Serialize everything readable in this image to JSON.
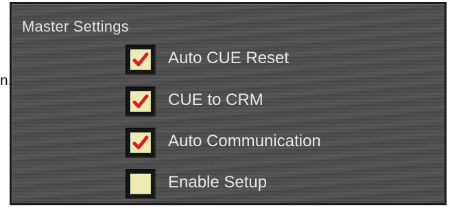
{
  "left_edge_char": "n.",
  "panel": {
    "title": "Master Settings",
    "options": [
      {
        "label": "Auto CUE Reset",
        "checked": true
      },
      {
        "label": "CUE to CRM",
        "checked": true
      },
      {
        "label": "Auto Communication",
        "checked": true
      },
      {
        "label": "Enable Setup",
        "checked": false
      }
    ]
  },
  "colors": {
    "panel_background": "#4d4d4d",
    "checkbox_face": "#ecebb4",
    "check_mark": "#d81e1e",
    "text": "#e8e8e8"
  },
  "icons": {
    "checked": "check-mark-icon"
  }
}
